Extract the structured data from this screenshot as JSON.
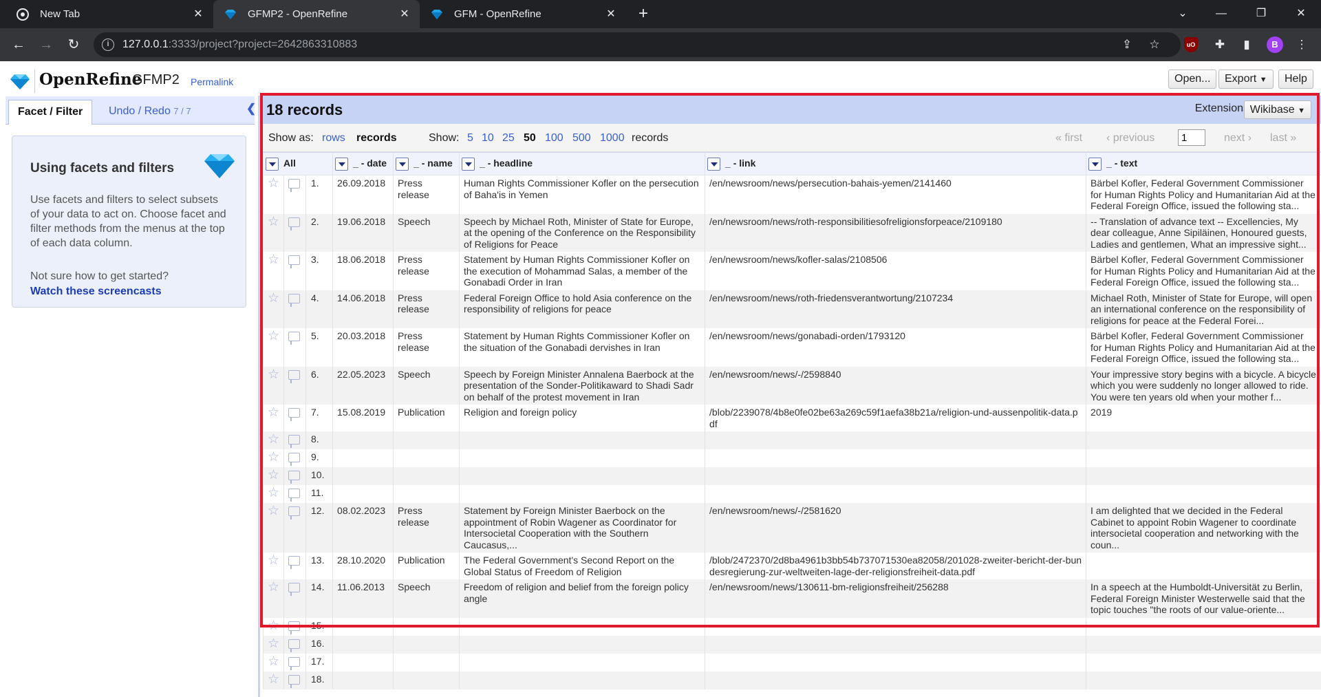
{
  "browser": {
    "tabs": [
      {
        "label": "New Tab",
        "icon": "chrome-icon",
        "active": false
      },
      {
        "label": "GFMP2 - OpenRefine",
        "icon": "openrefine-gem-icon",
        "active": true
      },
      {
        "label": "GFM - OpenRefine",
        "icon": "openrefine-gem-icon",
        "active": false
      }
    ],
    "url_host": "127.0.0.1",
    "url_rest": ":3333/project?project=2642863310883",
    "profile_initial": "B"
  },
  "header": {
    "app_name": "OpenRefine",
    "project_name": "GFMP2",
    "permalink": "Permalink",
    "open_label": "Open...",
    "export_label": "Export",
    "help_label": "Help"
  },
  "left": {
    "tab_facet": "Facet / Filter",
    "tab_undo": "Undo / Redo",
    "undo_count": "7 / 7",
    "help_title": "Using facets and filters",
    "help_body": "Use facets and filters to select subsets of your data to act on. Choose facet and filter methods from the menus at the top of each data column.",
    "help_question": "Not sure how to get started?",
    "help_link": "Watch these screencasts"
  },
  "grid": {
    "records_count": "18 records",
    "extensions_label": "Extensions",
    "wikibase_label": "Wikibase",
    "show_as_label": "Show as:",
    "rows_label": "rows",
    "records_label": "records",
    "show_label": "Show:",
    "page_sizes": [
      "5",
      "10",
      "25",
      "50",
      "100",
      "500",
      "1000"
    ],
    "page_size_selected": "50",
    "records_suffix": "records",
    "first_label": "« first",
    "previous_label": "‹ previous",
    "page_value": "1",
    "next_label": "next ›",
    "last_label": "last »",
    "columns": [
      "All",
      "_ - date",
      "_ - name",
      "_ - headline",
      "_ - link",
      "_ - text"
    ],
    "rows": [
      {
        "n": "1.",
        "date": "26.09.2018",
        "name": "Press release",
        "headline": "Human Rights Commissioner Kofler on the persecution of Baha'is in Yemen",
        "link": "/en/newsroom/news/persecution-bahais-yemen/2141460",
        "text": "Bärbel Kofler, Federal Government Commissioner for Human Rights Policy and Humanitarian Aid at the Federal Foreign Office, issued the following sta..."
      },
      {
        "n": "2.",
        "date": "19.06.2018",
        "name": "Speech",
        "headline": "Speech by Michael Roth, Minister of State for Europe, at the opening of the Conference on the Responsibility of Religions for Peace",
        "link": "/en/newsroom/news/roth-responsibilitiesofreligionsforpeace/2109180",
        "text": "-- Translation of advance text -- Excellencies, My dear colleague, Anne Sipiläinen, Honoured guests, Ladies and gentlemen, What an impressive sight..."
      },
      {
        "n": "3.",
        "date": "18.06.2018",
        "name": "Press release",
        "headline": "Statement by Human Rights Commissioner Kofler on the execution of Mohammad Salas, a member of the Gonabadi Order in Iran",
        "link": "/en/newsroom/news/kofler-salas/2108506",
        "text": "Bärbel Kofler, Federal Government Commissioner for Human Rights Policy and Humanitarian Aid at the Federal Foreign Office, issued the following sta..."
      },
      {
        "n": "4.",
        "date": "14.06.2018",
        "name": "Press release",
        "headline": "Federal Foreign Office to hold Asia conference on the responsibility of religions for peace",
        "link": "/en/newsroom/news/roth-friedensverantwortung/2107234",
        "text": "Michael Roth, Minister of State for Europe, will open an international conference on the responsibility of religions for peace at the Federal Forei..."
      },
      {
        "n": "5.",
        "date": "20.03.2018",
        "name": "Press release",
        "headline": "Statement by Human Rights Commissioner Kofler on the situation of the Gonabadi dervishes in Iran",
        "link": "/en/newsroom/news/gonabadi-orden/1793120",
        "text": "Bärbel Kofler, Federal Government Commissioner for Human Rights Policy and Humanitarian Aid at the Federal Foreign Office, issued the following sta..."
      },
      {
        "n": "6.",
        "date": "22.05.2023",
        "name": "Speech",
        "headline": "Speech by Foreign Minister Annalena Baerbock at the presentation of the Sonder-Politikaward to Shadi Sadr on behalf of the protest movement in Iran",
        "link": "/en/newsroom/news/-/2598840",
        "text": "Your impressive story begins with a bicycle. A bicycle which you were suddenly no longer allowed to ride. You were ten years old when your mother f..."
      },
      {
        "n": "7.",
        "date": "15.08.2019",
        "name": "Publication",
        "headline": "Religion and foreign policy",
        "link": "/blob/2239078/4b8e0fe02be63a269c59f1aefa38b21a/religion-und-aussenpolitik-data.pdf",
        "text": "2019"
      },
      {
        "n": "8.",
        "date": "",
        "name": "",
        "headline": "",
        "link": "",
        "text": ""
      },
      {
        "n": "9.",
        "date": "",
        "name": "",
        "headline": "",
        "link": "",
        "text": ""
      },
      {
        "n": "10.",
        "date": "",
        "name": "",
        "headline": "",
        "link": "",
        "text": ""
      },
      {
        "n": "11.",
        "date": "",
        "name": "",
        "headline": "",
        "link": "",
        "text": ""
      },
      {
        "n": "12.",
        "date": "08.02.2023",
        "name": "Press release",
        "headline": "Statement by Foreign Minister Baerbock on the appointment of Robin Wagener as Coordinator for Intersocietal Cooperation with the Southern Caucasus,...",
        "link": "/en/newsroom/news/-/2581620",
        "text": "I am delighted that we decided in the Federal Cabinet to appoint Robin Wagener to coordinate intersocietal cooperation and networking with the coun..."
      },
      {
        "n": "13.",
        "date": "28.10.2020",
        "name": "Publication",
        "headline": "The Federal Government's Second Report on the Global Status of Freedom of Religion",
        "link": "/blob/2472370/2d8ba4961b3bb54b737071530ea82058/201028-zweiter-bericht-der-bundesregierung-zur-weltweiten-lage-der-religionsfreiheit-data.pdf",
        "text": ""
      },
      {
        "n": "14.",
        "date": "11.06.2013",
        "name": "Speech",
        "headline": "Freedom of religion and belief from the foreign policy angle",
        "link": "/en/newsroom/news/130611-bm-religionsfreiheit/256288",
        "text": "In a speech at the Humboldt-Universität zu Berlin, Federal Foreign Minister Westerwelle said that the topic touches \"the roots of our value-oriente..."
      },
      {
        "n": "15.",
        "date": "",
        "name": "",
        "headline": "",
        "link": "",
        "text": ""
      },
      {
        "n": "16.",
        "date": "",
        "name": "",
        "headline": "",
        "link": "",
        "text": ""
      },
      {
        "n": "17.",
        "date": "",
        "name": "",
        "headline": "",
        "link": "",
        "text": ""
      },
      {
        "n": "18.",
        "date": "",
        "name": "",
        "headline": "",
        "link": "",
        "text": ""
      }
    ]
  },
  "colors": {
    "accent_link": "#3a5fcd",
    "highlight_frame": "#e0192c",
    "summary_bg": "#c7d3f5"
  }
}
